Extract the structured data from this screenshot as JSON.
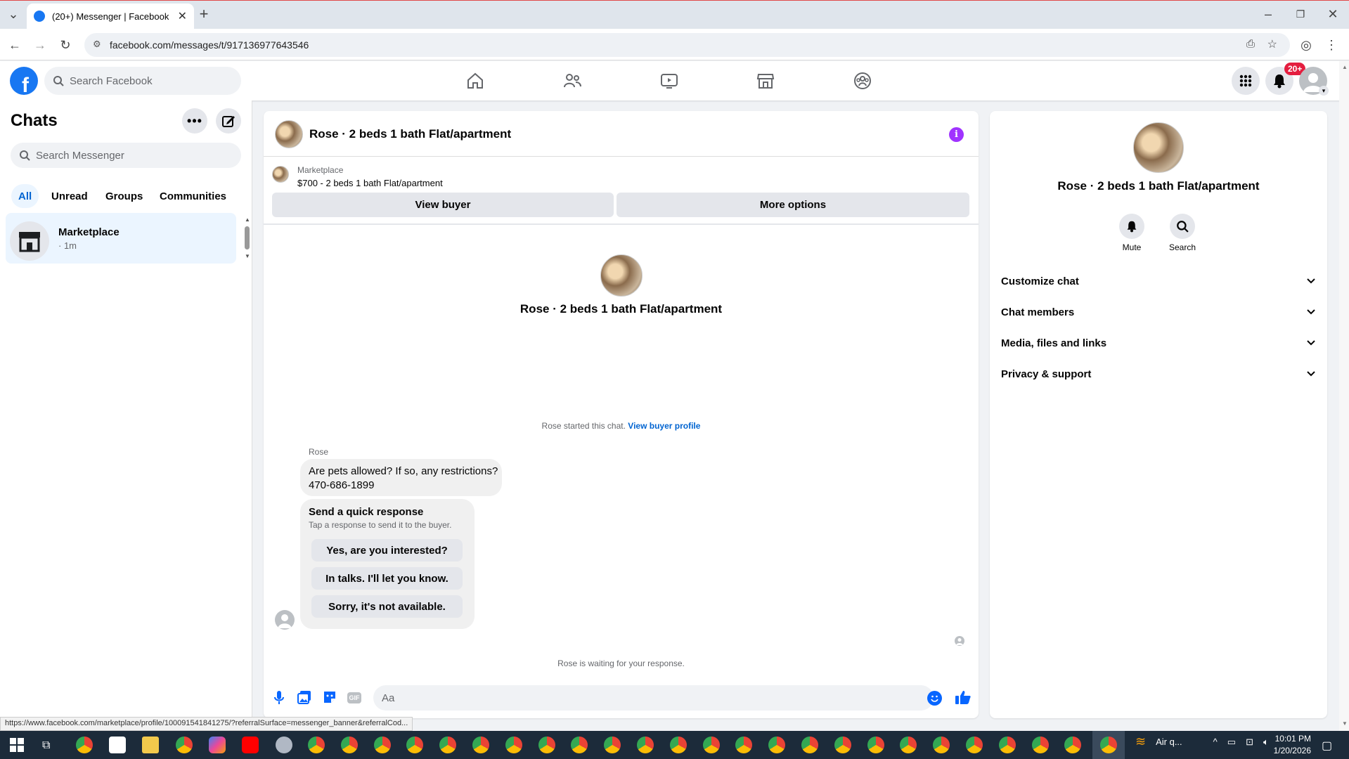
{
  "browser": {
    "tab_title": "(20+) Messenger | Facebook",
    "url": "facebook.com/messages/t/917136977643546",
    "status_url": "https://www.facebook.com/marketplace/profile/100091541841275/?referralSurface=messenger_banner&referralCod..."
  },
  "header": {
    "search_placeholder": "Search Facebook",
    "notif_count": "20+"
  },
  "sidebar": {
    "title": "Chats",
    "search_placeholder": "Search Messenger",
    "filters": [
      "All",
      "Unread",
      "Groups",
      "Communities"
    ],
    "chats": [
      {
        "name": "Marketplace",
        "time": "· 1m"
      }
    ]
  },
  "conversation": {
    "title": "Rose · 2 beds 1 bath Flat/apartment",
    "listing": {
      "source": "Marketplace",
      "summary": "$700 - 2 beds 1 bath Flat/apartment"
    },
    "buttons": {
      "view_buyer": "View buyer",
      "more_options": "More options"
    },
    "intro_name": "Rose · 2 beds 1 bath Flat/apartment",
    "started_text": "Rose started this chat.",
    "view_buyer_profile": "View buyer profile",
    "sender": "Rose",
    "message_line1": "Are pets allowed? If so, any restrictions?",
    "message_line2": "470-686-1899",
    "quick": {
      "title": "Send a quick response",
      "subtitle": "Tap a response to send it to the buyer.",
      "options": [
        "Yes, are you interested?",
        "In talks. I'll let you know.",
        "Sorry, it's not available."
      ]
    },
    "waiting": "Rose is waiting for your response.",
    "composer_placeholder": "Aa"
  },
  "right_panel": {
    "name": "Rose · 2 beds 1 bath Flat/apartment",
    "actions": {
      "mute": "Mute",
      "search": "Search"
    },
    "sections": [
      "Customize chat",
      "Chat members",
      "Media, files and links",
      "Privacy & support"
    ]
  },
  "taskbar": {
    "weather": "Air q...",
    "time": "10:01 PM",
    "date": "1/20/2026"
  },
  "colors": {
    "fb_blue": "#1877f2",
    "link_blue": "#0064d1",
    "badge_red": "#e41e3f",
    "info_purple": "#a033ff"
  }
}
